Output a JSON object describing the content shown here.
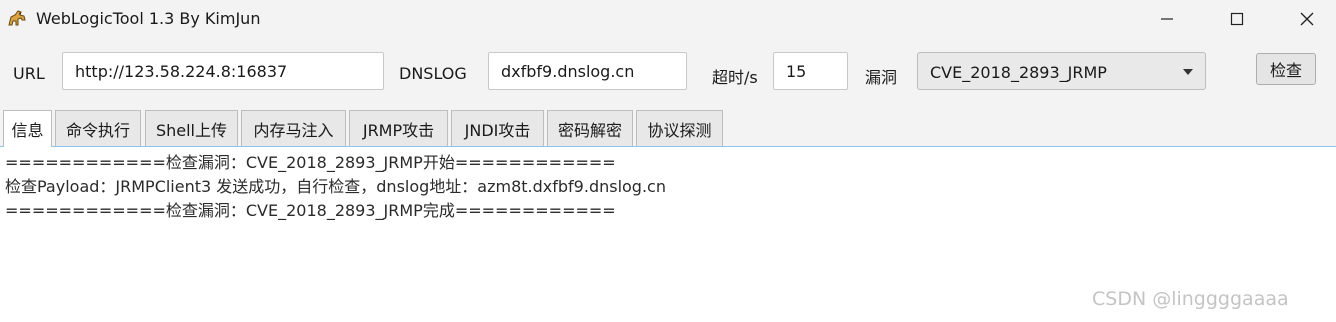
{
  "window": {
    "title": "WebLogicTool 1.3 By KimJun",
    "icons": [
      "app-horse-icon",
      "minimize-icon",
      "maximize-icon",
      "close-icon"
    ]
  },
  "toolbar": {
    "url_label": "URL",
    "url_value": "http://123.58.224.8:16837",
    "dnslog_label": "DNSLOG",
    "dnslog_value": "dxfbf9.dnslog.cn",
    "timeout_label": "超时/s",
    "timeout_value": "15",
    "vuln_label": "漏洞",
    "vuln_selected": "CVE_2018_2893_JRMP",
    "check_label": "检查"
  },
  "tabs": [
    {
      "label": "信息",
      "active": true
    },
    {
      "label": "命令执行",
      "active": false
    },
    {
      "label": "Shell上传",
      "active": false
    },
    {
      "label": "内存马注入",
      "active": false
    },
    {
      "label": "JRMP攻击",
      "active": false
    },
    {
      "label": "JNDI攻击",
      "active": false
    },
    {
      "label": "密码解密",
      "active": false
    },
    {
      "label": "协议探测",
      "active": false
    }
  ],
  "output": {
    "lines": [
      "============检查漏洞：CVE_2018_2893_JRMP开始============",
      "检查Payload：JRMPClient3 发送成功，自行检查，dnslog地址：azm8t.dxfbf9.dnslog.cn",
      "============检查漏洞：CVE_2018_2893_JRMP完成============"
    ]
  },
  "watermark": "CSDN @linggggaaaa",
  "colors": {
    "chrome_bg": "#f3f3f3",
    "tab_accent": "#8fc5e8",
    "watermark": "#c4c4c4"
  }
}
